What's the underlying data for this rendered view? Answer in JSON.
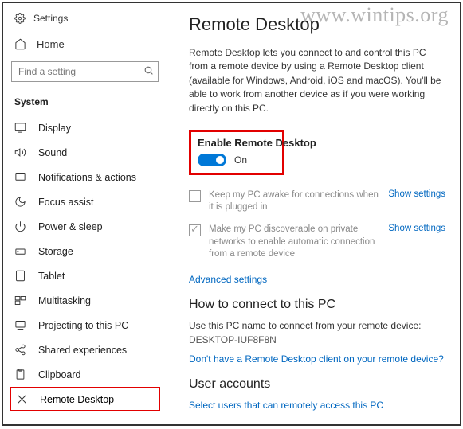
{
  "watermark": "www.wintips.org",
  "header": {
    "title": "Settings"
  },
  "home": {
    "label": "Home"
  },
  "search": {
    "placeholder": "Find a setting"
  },
  "section": "System",
  "nav": [
    {
      "label": "Display"
    },
    {
      "label": "Sound"
    },
    {
      "label": "Notifications & actions"
    },
    {
      "label": "Focus assist"
    },
    {
      "label": "Power & sleep"
    },
    {
      "label": "Storage"
    },
    {
      "label": "Tablet"
    },
    {
      "label": "Multitasking"
    },
    {
      "label": "Projecting to this PC"
    },
    {
      "label": "Shared experiences"
    },
    {
      "label": "Clipboard"
    },
    {
      "label": "Remote Desktop"
    }
  ],
  "main": {
    "title": "Remote Desktop",
    "desc": "Remote Desktop lets you connect to and control this PC from a remote device by using a Remote Desktop client (available for Windows, Android, iOS and macOS). You'll be able to work from another device as if you were working directly on this PC.",
    "enable_title": "Enable Remote Desktop",
    "toggle_state": "On",
    "check1": "Keep my PC awake for connections when it is plugged in",
    "check2": "Make my PC discoverable on private networks to enable automatic connection from a remote device",
    "show_settings": "Show settings",
    "advanced": "Advanced settings",
    "connect_title": "How to connect to this PC",
    "connect_desc": "Use this PC name to connect from your remote device:",
    "pc_name": "DESKTOP-IUF8F8N",
    "no_client": "Don't have a Remote Desktop client on your remote device?",
    "accounts_title": "User accounts",
    "select_users": "Select users that can remotely access this PC"
  }
}
